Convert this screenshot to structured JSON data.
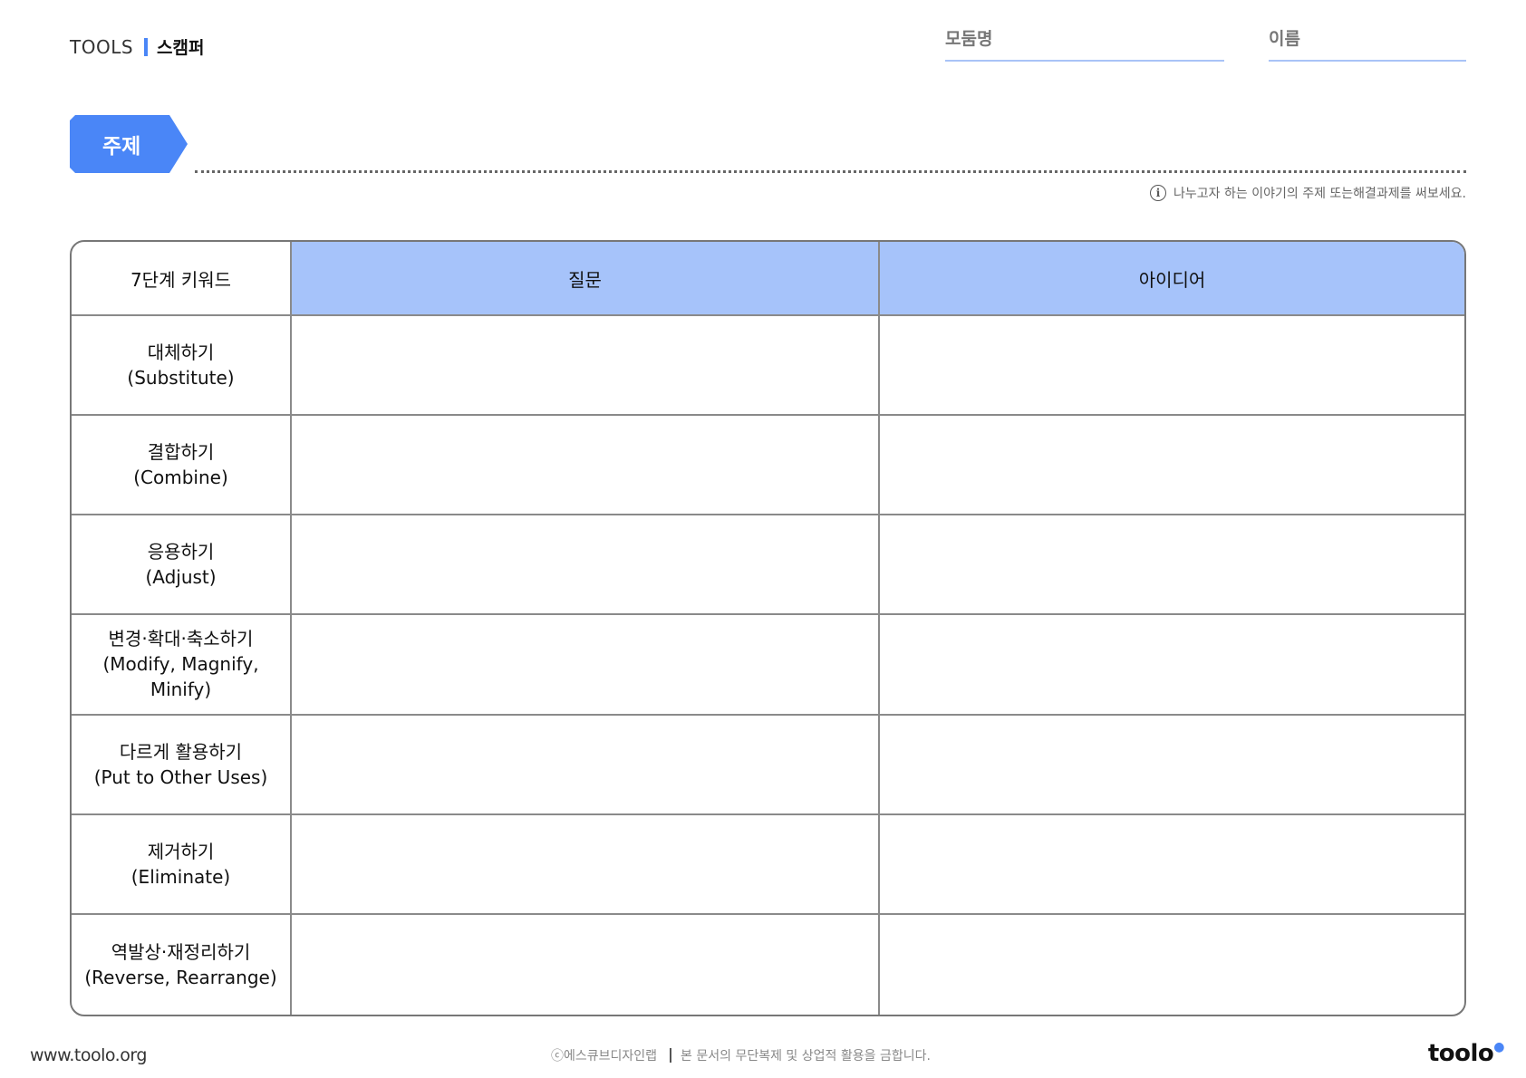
{
  "header": {
    "tools_label": "TOOLS",
    "tool_name": "스캠퍼",
    "group_label": "모둠명",
    "name_label": "이름"
  },
  "topic": {
    "tag": "주제",
    "hint": "나누고자 하는 이야기의 주제 또는해결과제를 써보세요."
  },
  "table": {
    "headers": [
      "7단계 키워드",
      "질문",
      "아이디어"
    ],
    "rows": [
      {
        "ko": "대체하기",
        "en": "(Substitute)"
      },
      {
        "ko": "결합하기",
        "en": "(Combine)"
      },
      {
        "ko": "응용하기",
        "en": "(Adjust)"
      },
      {
        "ko": "변경·확대·축소하기",
        "en": "(Modify, Magnify, Minify)"
      },
      {
        "ko": "다르게 활용하기",
        "en": "(Put to Other Uses)"
      },
      {
        "ko": "제거하기",
        "en": "(Eliminate)"
      },
      {
        "ko": "역발상·재정리하기",
        "en": "(Reverse, Rearrange)"
      }
    ]
  },
  "footer": {
    "url": "www.toolo.org",
    "copyright": "ⓒ에스큐브디자인랩",
    "notice": "본 문서의 무단복제 및 상업적 활용을 금합니다.",
    "logo": "toolo"
  },
  "colors": {
    "accent": "#4a86f7",
    "header_fill": "#a6c3fa"
  }
}
